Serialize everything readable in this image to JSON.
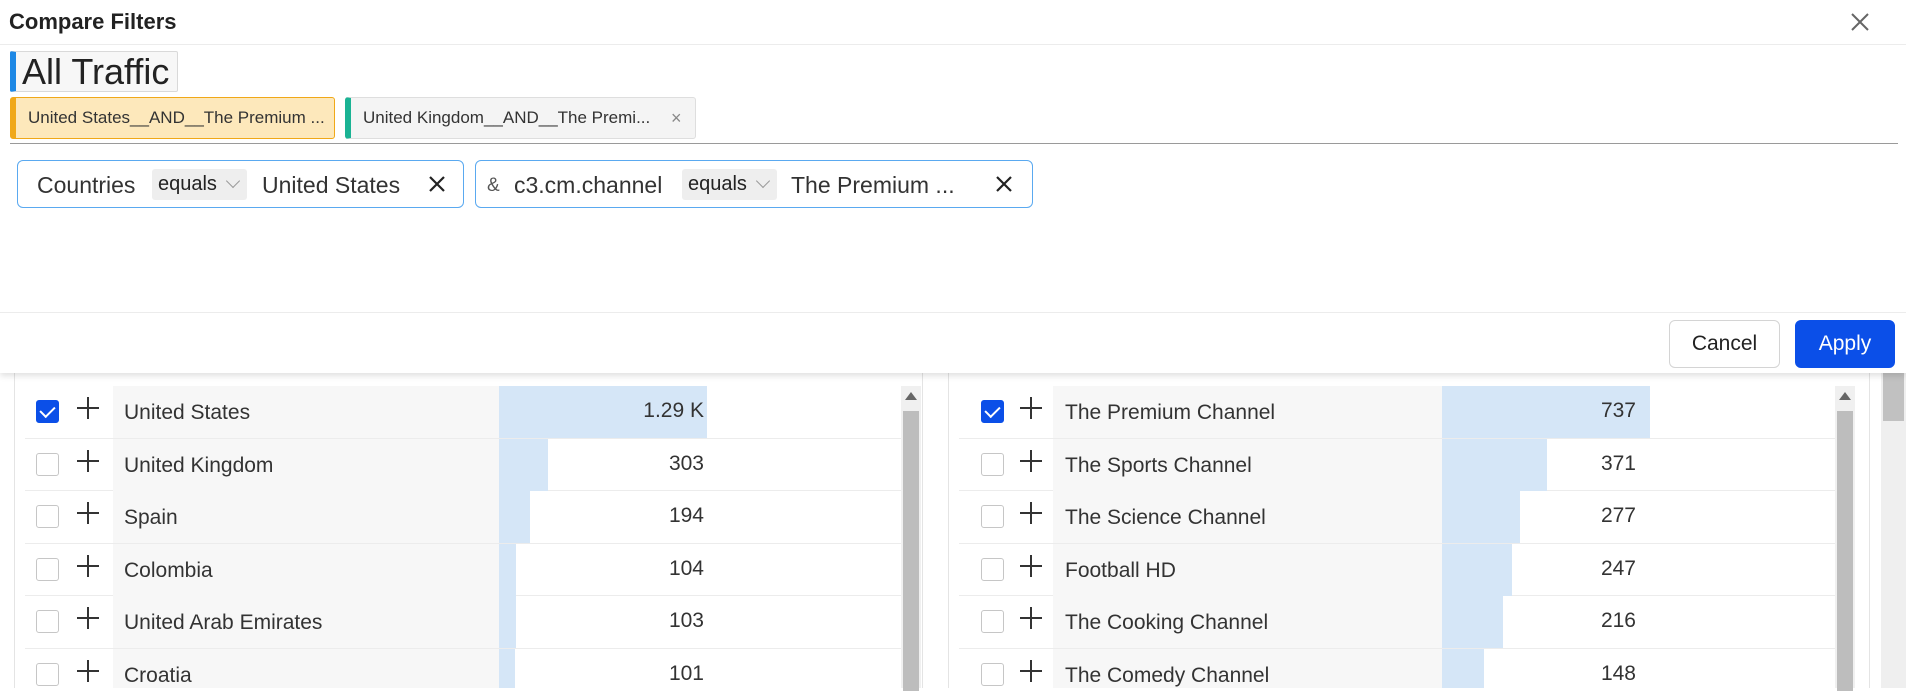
{
  "modal": {
    "title": "Compare Filters",
    "close_icon": "close-icon",
    "segment": "All Traffic",
    "tabs": [
      {
        "label": "United States__AND__The Premium ...",
        "active": true,
        "color": "#f0a818"
      },
      {
        "label": "United Kingdom__AND__The Premi...",
        "active": false,
        "color": "#1ab394",
        "close": "×"
      }
    ],
    "filters": [
      {
        "field": "Countries",
        "operator": "equals",
        "value": "United States"
      },
      {
        "prefix": "&",
        "field": "c3.cm.channel",
        "operator": "equals",
        "value": "The Premium ..."
      }
    ],
    "cancel_label": "Cancel",
    "apply_label": "Apply",
    "accent": "#0b4fe8"
  },
  "countries_list": {
    "max": 1290,
    "rows": [
      {
        "label": "United States",
        "value": 1290,
        "display": "1.29 K",
        "checked": true
      },
      {
        "label": "United Kingdom",
        "value": 303,
        "display": "303",
        "checked": false
      },
      {
        "label": "Spain",
        "value": 194,
        "display": "194",
        "checked": false
      },
      {
        "label": "Colombia",
        "value": 104,
        "display": "104",
        "checked": false
      },
      {
        "label": "United Arab Emirates",
        "value": 103,
        "display": "103",
        "checked": false
      },
      {
        "label": "Croatia",
        "value": 101,
        "display": "101",
        "checked": false
      }
    ]
  },
  "channels_list": {
    "max": 737,
    "rows": [
      {
        "label": "The Premium Channel",
        "value": 737,
        "display": "737",
        "checked": true
      },
      {
        "label": "The Sports Channel",
        "value": 371,
        "display": "371",
        "checked": false
      },
      {
        "label": "The Science Channel",
        "value": 277,
        "display": "277",
        "checked": false
      },
      {
        "label": "Football HD",
        "value": 247,
        "display": "247",
        "checked": false
      },
      {
        "label": "The Cooking Channel",
        "value": 216,
        "display": "216",
        "checked": false
      },
      {
        "label": "The Comedy Channel",
        "value": 148,
        "display": "148",
        "checked": false
      }
    ]
  }
}
